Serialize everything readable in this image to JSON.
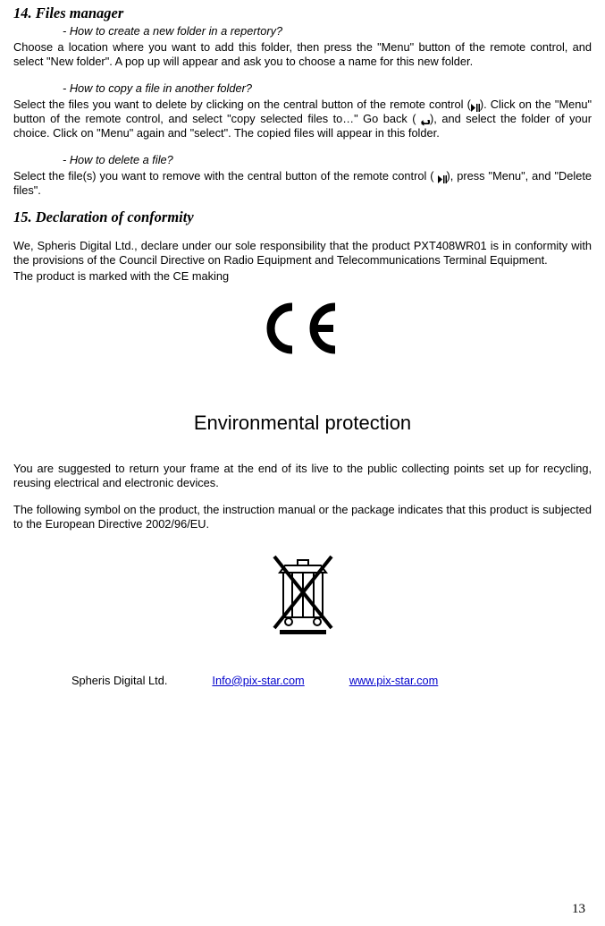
{
  "s14": {
    "title": "14. Files manager",
    "q1": "- How to create a new folder in a repertory?",
    "a1": "Choose a location where you want to add this folder, then press the \"Menu\" button of the remote control, and select \"New folder\". A pop up will appear and ask you to choose a name for this new folder.",
    "q2": "- How to copy a file in another folder?",
    "a2_pre": "Select the files you want to delete by clicking on the central button of the remote control (",
    "a2_mid": "). Click on the \"Menu\" button of the remote control, and select \"copy selected files to…\" Go back (",
    "a2_post": "), and select the folder of your choice. Click on \"Menu\" again and \"select\". The copied files will appear in this folder.",
    "q3": "- How to delete a file?",
    "a3_pre": "Select the file(s) you want to remove with the central button of the remote control (",
    "a3_post": "), press \"Menu\", and \"Delete files\"."
  },
  "s15": {
    "title": "15. Declaration of conformity",
    "p1": "We, Spheris Digital Ltd., declare under our sole responsibility that the product PXT408WR01 is in conformity with the provisions of the Council Directive on Radio Equipment and Telecommunications Terminal Equipment.",
    "p2": "The product is marked with the CE making"
  },
  "env": {
    "title": "Environmental protection",
    "p1": "You are suggested to return your frame at the end of its live to the public collecting points set up for recycling, reusing electrical and electronic devices.",
    "p2": "The following symbol on the product, the instruction manual or the package indicates that this product is subjected to the European Directive 2002/96/EU."
  },
  "footer": {
    "company": "Spheris Digital Ltd.",
    "email": "Info@pix-star.com",
    "website": "www.pix-star.com"
  },
  "page": "13"
}
